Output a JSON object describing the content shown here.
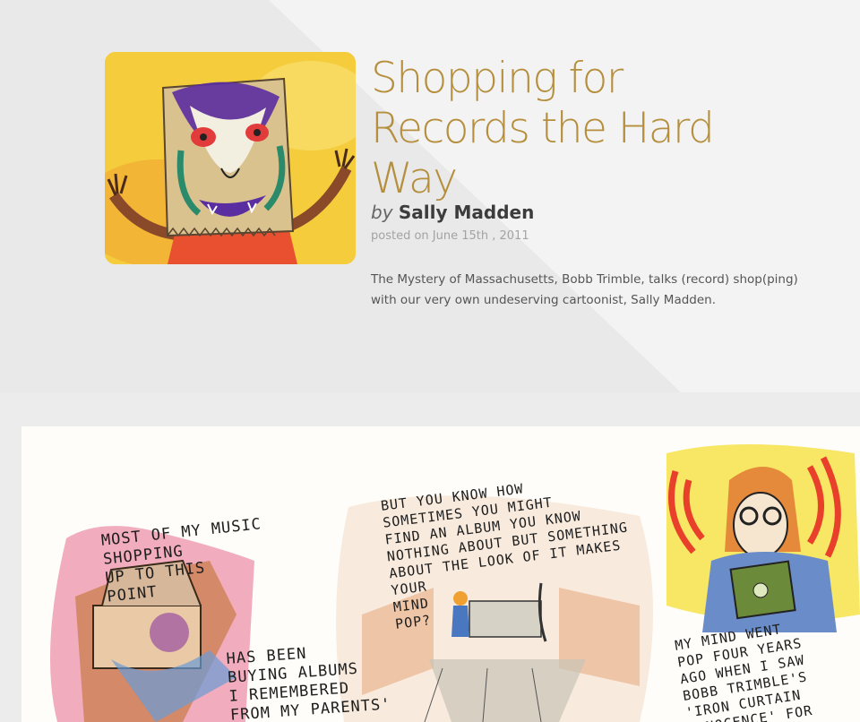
{
  "article": {
    "title": "Shopping for Records the Hard Way",
    "by_label": "by",
    "author": "Sally Madden",
    "posted": "posted on June 15th , 2011",
    "description": "The Mystery of Massachusetts, Bobb Trimble, talks (record) shop(ping) with our very own undeserving cartoonist, Sally Madden."
  },
  "comic": {
    "panel1_text_a": "MOST OF MY MUSIC\nSHOPPING\nUP TO THIS\nPOINT",
    "panel1_text_b": "HAS BEEN\nBUYING ALBUMS\nI REMEMBERED\nFROM MY PARENTS'",
    "panel2_text_a": "BUT YOU KNOW HOW\nSOMETIMES YOU MIGHT\nFIND AN ALBUM YOU KNOW\nNOTHING ABOUT BUT SOMETHING\nABOUT THE LOOK OF IT MAKES\nYOUR\nMIND\nPOP?",
    "panel3_text_a": "MY MIND WENT\nPOP FOUR YEARS\nAGO WHEN I SAW\nBOBB TRIMBLE'S\n'IRON CURTAIN\nINNOCENCE' FOR"
  },
  "colors": {
    "title": "#b58f3d",
    "background": "#ececec",
    "thumb_yellow": "#f5c93a"
  }
}
